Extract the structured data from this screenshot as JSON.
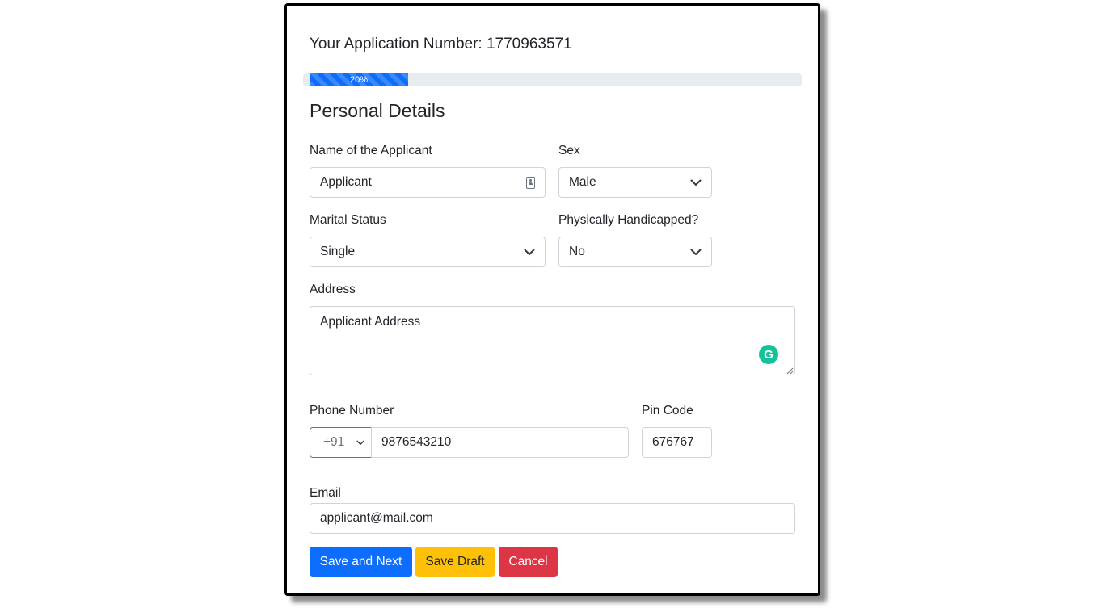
{
  "header": {
    "application_number_text": "Your Application Number: 1770963571"
  },
  "progress": {
    "value_percent": 20,
    "label": "20%",
    "color": "#0d6efd"
  },
  "section": {
    "title": "Personal Details"
  },
  "fields": {
    "name": {
      "label": "Name of the Applicant",
      "value": "Applicant"
    },
    "sex": {
      "label": "Sex",
      "selected": "Male"
    },
    "marital_status": {
      "label": "Marital Status",
      "selected": "Single"
    },
    "handicapped": {
      "label": "Physically Handicapped?",
      "selected": "No"
    },
    "address": {
      "label": "Address",
      "value": "Applicant Address"
    },
    "phone": {
      "label": "Phone Number",
      "country_code": "+91",
      "value": "9876543210"
    },
    "pin": {
      "label": "Pin Code",
      "value": "676767"
    },
    "email": {
      "label": "Email",
      "value": "applicant@mail.com"
    }
  },
  "buttons": {
    "save_next": "Save and Next",
    "save_draft": "Save Draft",
    "cancel": "Cancel"
  },
  "colors": {
    "primary": "#0d6efd",
    "warning": "#ffc107",
    "danger": "#dc3545",
    "grammarly": "#15c39a"
  },
  "icons": {
    "grammarly": "grammarly-icon",
    "chevron": "chevron-down-icon",
    "autofill": "contact-card-icon"
  }
}
